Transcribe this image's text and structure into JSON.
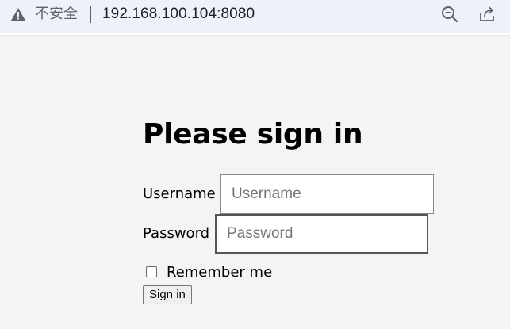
{
  "browser": {
    "security_label": "不安全",
    "url": "192.168.100.104:8080",
    "icons": {
      "warning": "warning-triangle-icon",
      "zoom": "zoom-out-icon",
      "share": "share-icon"
    }
  },
  "form": {
    "title": "Please sign in",
    "username": {
      "label": "Username",
      "placeholder": "Username",
      "value": ""
    },
    "password": {
      "label": "Password",
      "placeholder": "Password",
      "value": ""
    },
    "remember": {
      "label": "Remember me",
      "checked": false
    },
    "submit_label": "Sign in"
  },
  "colors": {
    "page_background": "#f4f4f4",
    "addressbar_background": "#edf2fa",
    "text": "#000000",
    "placeholder": "#767676"
  }
}
